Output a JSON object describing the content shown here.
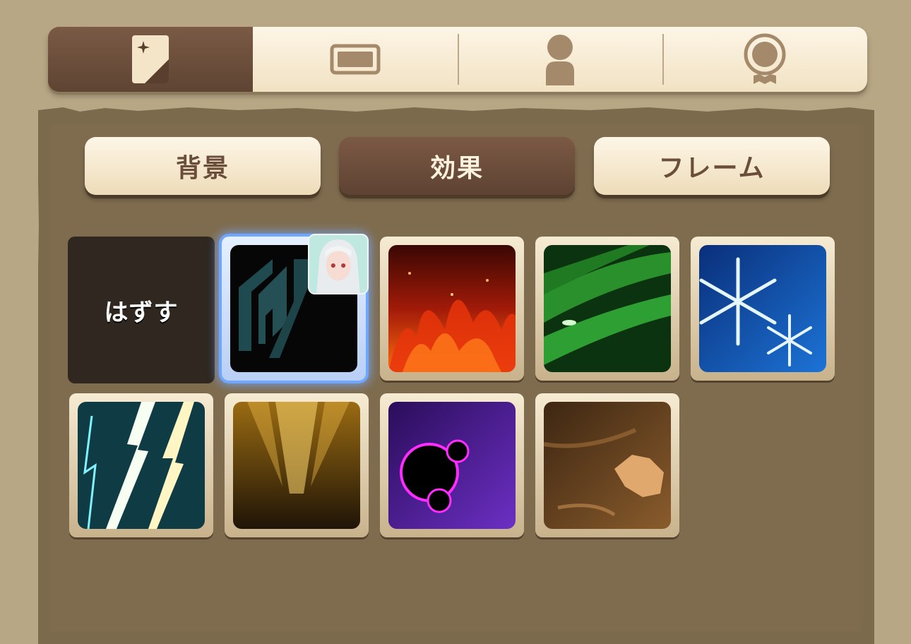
{
  "top_tabs": [
    {
      "id": "card",
      "icon": "card-icon",
      "active": true
    },
    {
      "id": "plate",
      "icon": "plate-icon",
      "active": false
    },
    {
      "id": "character",
      "icon": "person-icon",
      "active": false
    },
    {
      "id": "medal",
      "icon": "medal-icon",
      "active": false
    }
  ],
  "sub_tabs": {
    "background": "背景",
    "effect": "効果",
    "frame": "フレーム",
    "active": "effect"
  },
  "grid": {
    "remove_label": "はずす",
    "effects": [
      {
        "name": "rune-effect",
        "selected": true,
        "equipped": true
      },
      {
        "name": "fire-effect"
      },
      {
        "name": "wind-effect"
      },
      {
        "name": "ice-effect"
      },
      {
        "name": "lightning-effect"
      },
      {
        "name": "light-effect"
      },
      {
        "name": "dark-effect"
      },
      {
        "name": "earth-effect"
      }
    ]
  },
  "colors": {
    "accent_brown": "#6b4f3c",
    "tab_cream": "#fdf5e6",
    "selection_blue": "#6ea7ff"
  }
}
